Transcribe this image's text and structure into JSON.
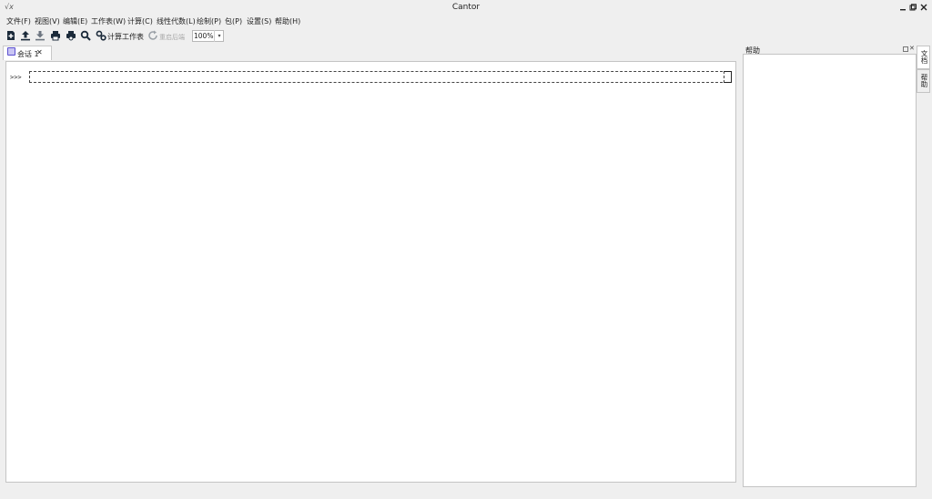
{
  "window": {
    "app_icon": "√x",
    "title": "Cantor",
    "controls": {
      "minimize": "▁",
      "restore": "▣",
      "close": "✕"
    }
  },
  "menubar": [
    "文件(F)",
    "视图(V)",
    "编辑(E)",
    "工作表(W)",
    "计算(C)",
    "线性代数(L)",
    "绘制(P)",
    "包(P)",
    "设置(S)",
    "帮助(H)"
  ],
  "toolbar": {
    "icons": [
      "new-icon",
      "upload-icon",
      "download-icon",
      "print-icon",
      "print-preview-icon",
      "search-icon",
      "evaluate-icon",
      "restart-icon"
    ],
    "evaluate_label": "计算工作表",
    "restart_label": "重启后端",
    "zoom_value": "100%",
    "zoom_arrow": "▾"
  },
  "tabs": [
    {
      "label": "会话 1",
      "close": "✕"
    }
  ],
  "worksheet": {
    "prompt": ">>>",
    "entry_value": ""
  },
  "side_panel": {
    "title": "帮助",
    "float_icon": "float-icon",
    "close": "✕"
  },
  "vertical_tabs": [
    "文档",
    "帮助"
  ],
  "colors": {
    "accent": "#5a4fcf",
    "icon_dark": "#1b2a3a"
  }
}
